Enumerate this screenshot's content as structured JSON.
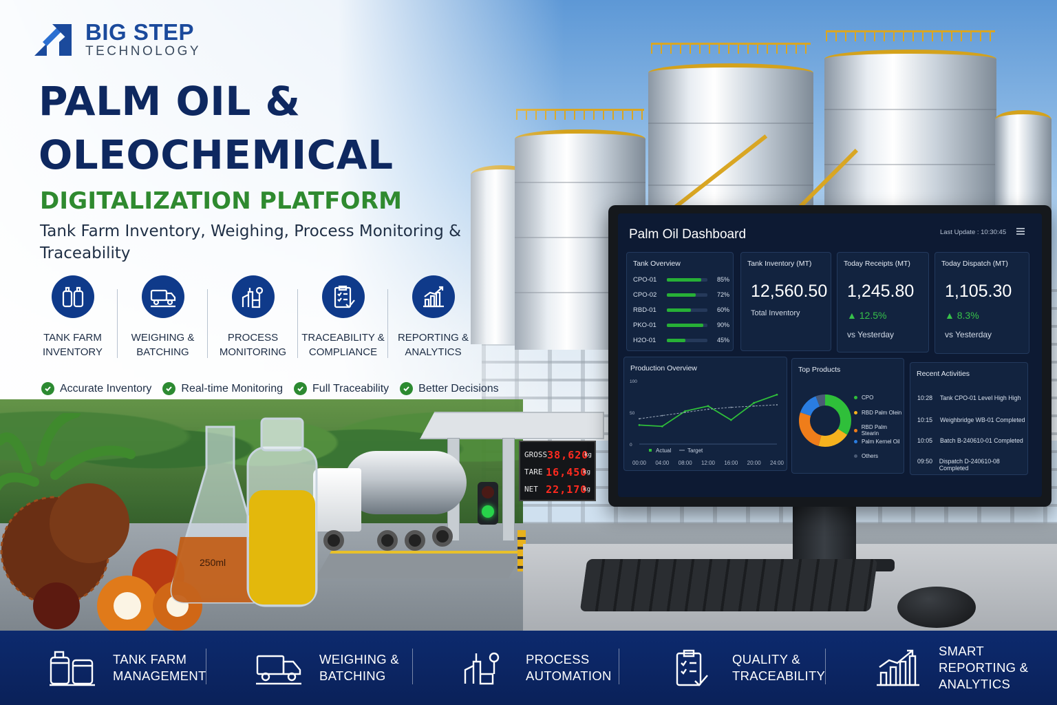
{
  "brand": {
    "name": "BIG STEP",
    "tagline": "TECHNOLOGY",
    "colors": {
      "navy": "#0e2860",
      "brand_blue": "#1b4a9c",
      "green": "#2f8a2f"
    }
  },
  "hero": {
    "headline_line1": "PALM OIL &",
    "headline_line2": "OLEOCHEMICAL",
    "headline_line3": "DIGITALIZATION PLATFORM",
    "subtitle": "Tank Farm Inventory, Weighing, Process Monitoring & Traceability"
  },
  "features": [
    {
      "icon": "tank-farm-icon",
      "label": "TANK FARM\nINVENTORY"
    },
    {
      "icon": "truck-scale-icon",
      "label": "WEIGHING &\nBATCHING"
    },
    {
      "icon": "process-plant-icon",
      "label": "PROCESS\nMONITORING"
    },
    {
      "icon": "clipboard-check-icon",
      "label": "TRACEABILITY &\nCOMPLIANCE"
    },
    {
      "icon": "bar-chart-icon",
      "label": "REPORTING &\nANALYTICS"
    }
  ],
  "benefits": [
    "Accurate Inventory",
    "Real-time Monitoring",
    "Full Traceability",
    "Better Decisions"
  ],
  "weighbridge_display": {
    "rows": [
      {
        "label": "GROSS",
        "value": "38,620",
        "unit": "kg"
      },
      {
        "label": "TARE",
        "value": "16,450",
        "unit": "kg"
      },
      {
        "label": "NET",
        "value": "22,170",
        "unit": "kg"
      }
    ]
  },
  "flask_label": "250ml",
  "dashboard": {
    "title": "Palm Oil Dashboard",
    "last_update": "Last Update : 10:30:45",
    "tank_overview": {
      "title": "Tank Overview",
      "tanks": [
        {
          "name": "CPO-01",
          "level": 85,
          "label": "85%"
        },
        {
          "name": "CPO-02",
          "level": 72,
          "label": "72%"
        },
        {
          "name": "RBD-01",
          "level": 60,
          "label": "60%"
        },
        {
          "name": "PKO-01",
          "level": 90,
          "label": "90%"
        },
        {
          "name": "H2O-01",
          "level": 45,
          "label": "45%"
        }
      ]
    },
    "kpis": [
      {
        "title": "Tank Inventory (MT)",
        "value": "12,560.50",
        "sub": "Total Inventory"
      },
      {
        "title": "Today Receipts (MT)",
        "value": "1,245.80",
        "delta": "▲ 12.5%",
        "vs": "vs Yesterday"
      },
      {
        "title": "Today Dispatch (MT)",
        "value": "1,105.30",
        "delta": "▲ 8.3%",
        "vs": "vs Yesterday"
      }
    ],
    "production": {
      "title": "Production Overview",
      "y_ticks": [
        "100",
        "50",
        "0"
      ],
      "legend_actual": "Actual",
      "legend_target": "Target",
      "colors": {
        "actual": "#2fbf3a",
        "target": "#9aa7b8"
      }
    },
    "top_products": {
      "title": "Top Products",
      "items": [
        {
          "name": "CPO",
          "color": "#2fbf3a"
        },
        {
          "name": "RBD Palm Olein",
          "color": "#f5b21e"
        },
        {
          "name": "RBD Palm Stearin",
          "color": "#ef7d1a"
        },
        {
          "name": "Palm Kernel Oil",
          "color": "#2a7de1"
        },
        {
          "name": "Others",
          "color": "#4a5a75"
        }
      ]
    },
    "recent_activities": {
      "title": "Recent Activities",
      "items": [
        {
          "time": "10:28",
          "text": "Tank CPO-01 Level High High"
        },
        {
          "time": "10:15",
          "text": "Weighbridge WB-01 Completed"
        },
        {
          "time": "10:05",
          "text": "Batch B-240610-01 Completed"
        },
        {
          "time": "09:50",
          "text": "Dispatch D-240610-08 Completed"
        }
      ]
    }
  },
  "footer": [
    {
      "icon": "tank-farm-icon",
      "label": "TANK FARM\nMANAGEMENT"
    },
    {
      "icon": "truck-scale-icon",
      "label": "WEIGHING &\nBATCHING"
    },
    {
      "icon": "process-plant-icon",
      "label": "PROCESS\nAUTOMATION"
    },
    {
      "icon": "clipboard-check-icon",
      "label": "QUALITY &\nTRACEABILITY"
    },
    {
      "icon": "bar-chart-icon",
      "label": "SMART REPORTING &\nANALYTICS"
    }
  ],
  "chart_data": {
    "type": "line",
    "title": "Production Overview",
    "x": [
      "00:00",
      "04:00",
      "08:00",
      "12:00",
      "16:00",
      "20:00",
      "24:00"
    ],
    "series": [
      {
        "name": "Actual",
        "values": [
          30,
          28,
          52,
          60,
          38,
          65,
          78
        ]
      },
      {
        "name": "Target",
        "values": [
          40,
          45,
          50,
          55,
          58,
          60,
          62
        ]
      }
    ],
    "ylim": [
      0,
      100
    ],
    "grid": false,
    "legend": "bottom-left"
  }
}
